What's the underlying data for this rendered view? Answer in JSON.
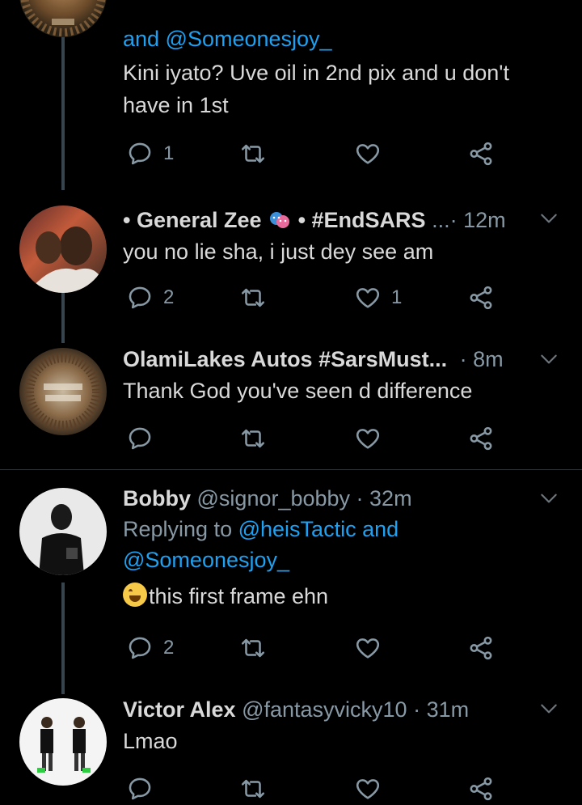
{
  "tweets": [
    {
      "reply_tail": "and @Someonesjoy_",
      "text_line1": "Kini iyato? Uve oil in 2nd pix and u don't",
      "text_line2": "have in 1st",
      "reply_count": "1",
      "retweet_count": "",
      "like_count": ""
    },
    {
      "name_prefix": "• General Zee",
      "name_suffix": "• #EndSARS",
      "handle_time": "...· 12m",
      "text": "you no lie sha, i just dey see am",
      "reply_count": "2",
      "retweet_count": "",
      "like_count": "1"
    },
    {
      "name": "OlamiLakes Autos #SarsMust...",
      "handle_time": "· 8m",
      "text": "Thank God you've seen d difference",
      "reply_count": "",
      "retweet_count": "",
      "like_count": ""
    },
    {
      "name": "Bobby",
      "handle_time": "@signor_bobby · 32m",
      "replying_to_label": "Replying to",
      "replying_to_users_line1": "@heisTactic and",
      "replying_to_users_line2": "@Someonesjoy_",
      "text": "this first frame ehn",
      "reply_count": "2",
      "retweet_count": "",
      "like_count": ""
    },
    {
      "name": "Victor Alex",
      "handle_time": "@fantasyvicky10 · 31m",
      "text": "Lmao",
      "reply_count": "",
      "retweet_count": "",
      "like_count": ""
    }
  ],
  "colors": {
    "background": "#000000",
    "text": "#d9d9d9",
    "muted": "#8899a6",
    "link": "#1da1f2",
    "thread_line": "#38444d"
  },
  "icons": [
    "reply-icon",
    "retweet-icon",
    "like-icon",
    "share-icon",
    "chevron-down-icon",
    "theater-mask-icon",
    "laughing-emoji-icon"
  ]
}
